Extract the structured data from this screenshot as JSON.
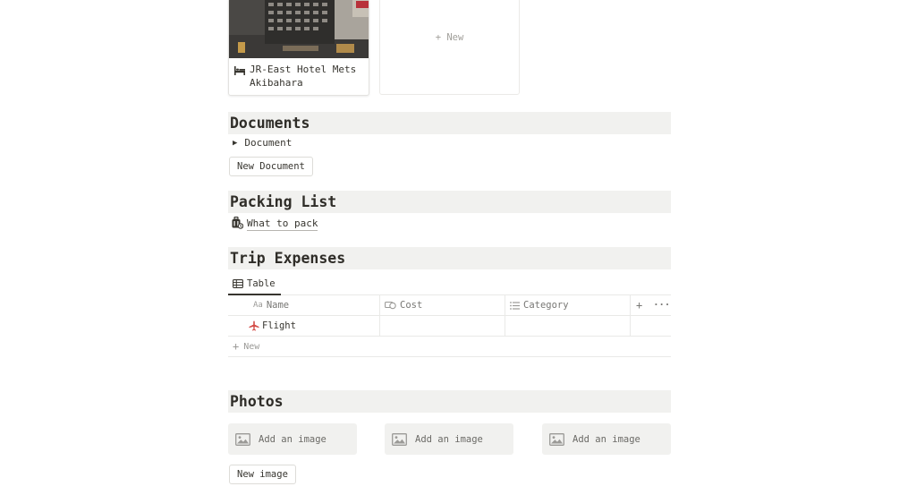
{
  "gallery": {
    "cards": [
      {
        "title": "JR-East Hotel Mets Akibahara",
        "icon": "bed-icon"
      }
    ],
    "new_label": "+ New"
  },
  "documents": {
    "heading": "Documents",
    "toggle_label": "Document",
    "new_button": "New Document"
  },
  "packing": {
    "heading": "Packing List",
    "link_label": "What to pack",
    "icon": "luggage-icon"
  },
  "expenses": {
    "heading": "Trip Expenses",
    "view_tab": "Table",
    "columns": {
      "name": "Name",
      "name_prefix": "Aa",
      "cost": "Cost",
      "category": "Category"
    },
    "rows": [
      {
        "name": "Flight",
        "icon": "airplane-icon",
        "cost": "",
        "category": ""
      }
    ],
    "add_col_symbol": "+",
    "more_symbol": "···",
    "new_row_label": "New",
    "accent": "#d44c47"
  },
  "photos": {
    "heading": "Photos",
    "placeholders": [
      "Add an image",
      "Add an image",
      "Add an image"
    ],
    "new_button": "New image"
  }
}
